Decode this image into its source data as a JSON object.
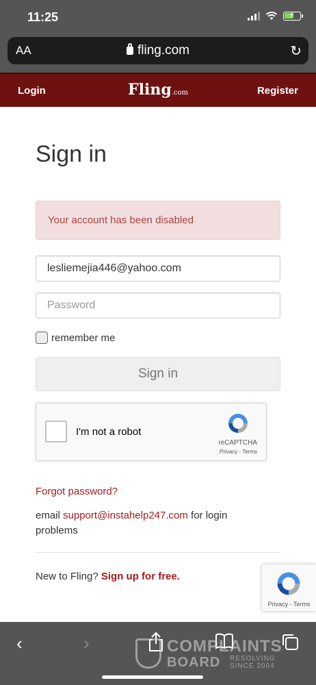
{
  "status_bar": {
    "time": "11:25"
  },
  "browser": {
    "text_size_label": "AA",
    "url": "fling.com"
  },
  "header": {
    "login": "Login",
    "logo": "Fling",
    "logo_suffix": ".com",
    "register": "Register"
  },
  "main": {
    "title": "Sign in",
    "alert": "Your account has been disabled",
    "email_value": "lesliemejia446@yahoo.com",
    "password_placeholder": "Password",
    "remember_label": "remember me",
    "signin_button": "Sign in",
    "forgot_link": "Forgot password?",
    "help_prefix": "email ",
    "help_email": "support@instahelp247.com",
    "help_suffix": " for login problems",
    "new_prefix": "New to Fling? ",
    "signup_link": "Sign up for free."
  },
  "recaptcha": {
    "label": "I'm not a robot",
    "brand": "reCAPTCHA",
    "privacy": "Privacy",
    "separator": " - ",
    "terms": "Terms"
  },
  "recaptcha_badge": {
    "privacy": "Privacy",
    "separator": " - ",
    "terms": "Terms"
  },
  "watermark": {
    "line1": "COMPLAINTS",
    "line2": "BOARD",
    "tag1": "RESOLVING",
    "tag2": "SINCE 2004"
  },
  "colors": {
    "header_bg": "#6e1111",
    "link": "#a01d1d",
    "alert_bg": "#f2dede",
    "alert_text": "#a94442"
  }
}
